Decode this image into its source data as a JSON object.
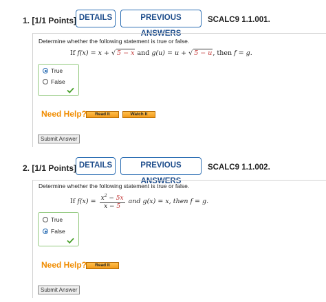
{
  "questions": [
    {
      "number": "1.",
      "points": "[1/1 Points]",
      "details_label": "DETAILS",
      "previous_answers_label": "PREVIOUS ANSWERS",
      "id": "SCALC9 1.1.001.",
      "prompt": "Determine whether the following statement is true or false.",
      "statement": {
        "if": "If",
        "f_of_x": "f(x) = x +",
        "sqrt_f": "5 − x",
        "and": "and",
        "g_of_u": "g(u) = u +",
        "sqrt_g": "5 − u",
        "then": ", then",
        "conclusion": "f = g."
      },
      "options": [
        {
          "label": "True",
          "selected": true
        },
        {
          "label": "False",
          "selected": false
        }
      ],
      "need_help_label": "Need Help?",
      "help_buttons": [
        "Read It",
        "Watch It"
      ],
      "submit_label": "Submit Answer"
    },
    {
      "number": "2.",
      "points": "[1/1 Points]",
      "details_label": "DETAILS",
      "previous_answers_label": "PREVIOUS ANSWERS",
      "id": "SCALC9 1.1.002.",
      "prompt": "Determine whether the following statement is true or false.",
      "statement": {
        "if": "If",
        "f_of_x": "f(x) =",
        "numerator_a": "x",
        "numerator_exp": "2",
        "numerator_b": " − ",
        "numerator_c": "5x",
        "denominator_a": "x − ",
        "denominator_b": "5",
        "rest": "and g(x) = x, then f = g."
      },
      "options": [
        {
          "label": "True",
          "selected": false
        },
        {
          "label": "False",
          "selected": true
        }
      ],
      "need_help_label": "Need Help?",
      "help_buttons": [
        "Read It"
      ],
      "submit_label": "Submit Answer"
    }
  ],
  "colors": {
    "accent": "#2a6db3",
    "help": "#f08c00",
    "correct": "#4aa02c",
    "highlight": "#c03030"
  }
}
